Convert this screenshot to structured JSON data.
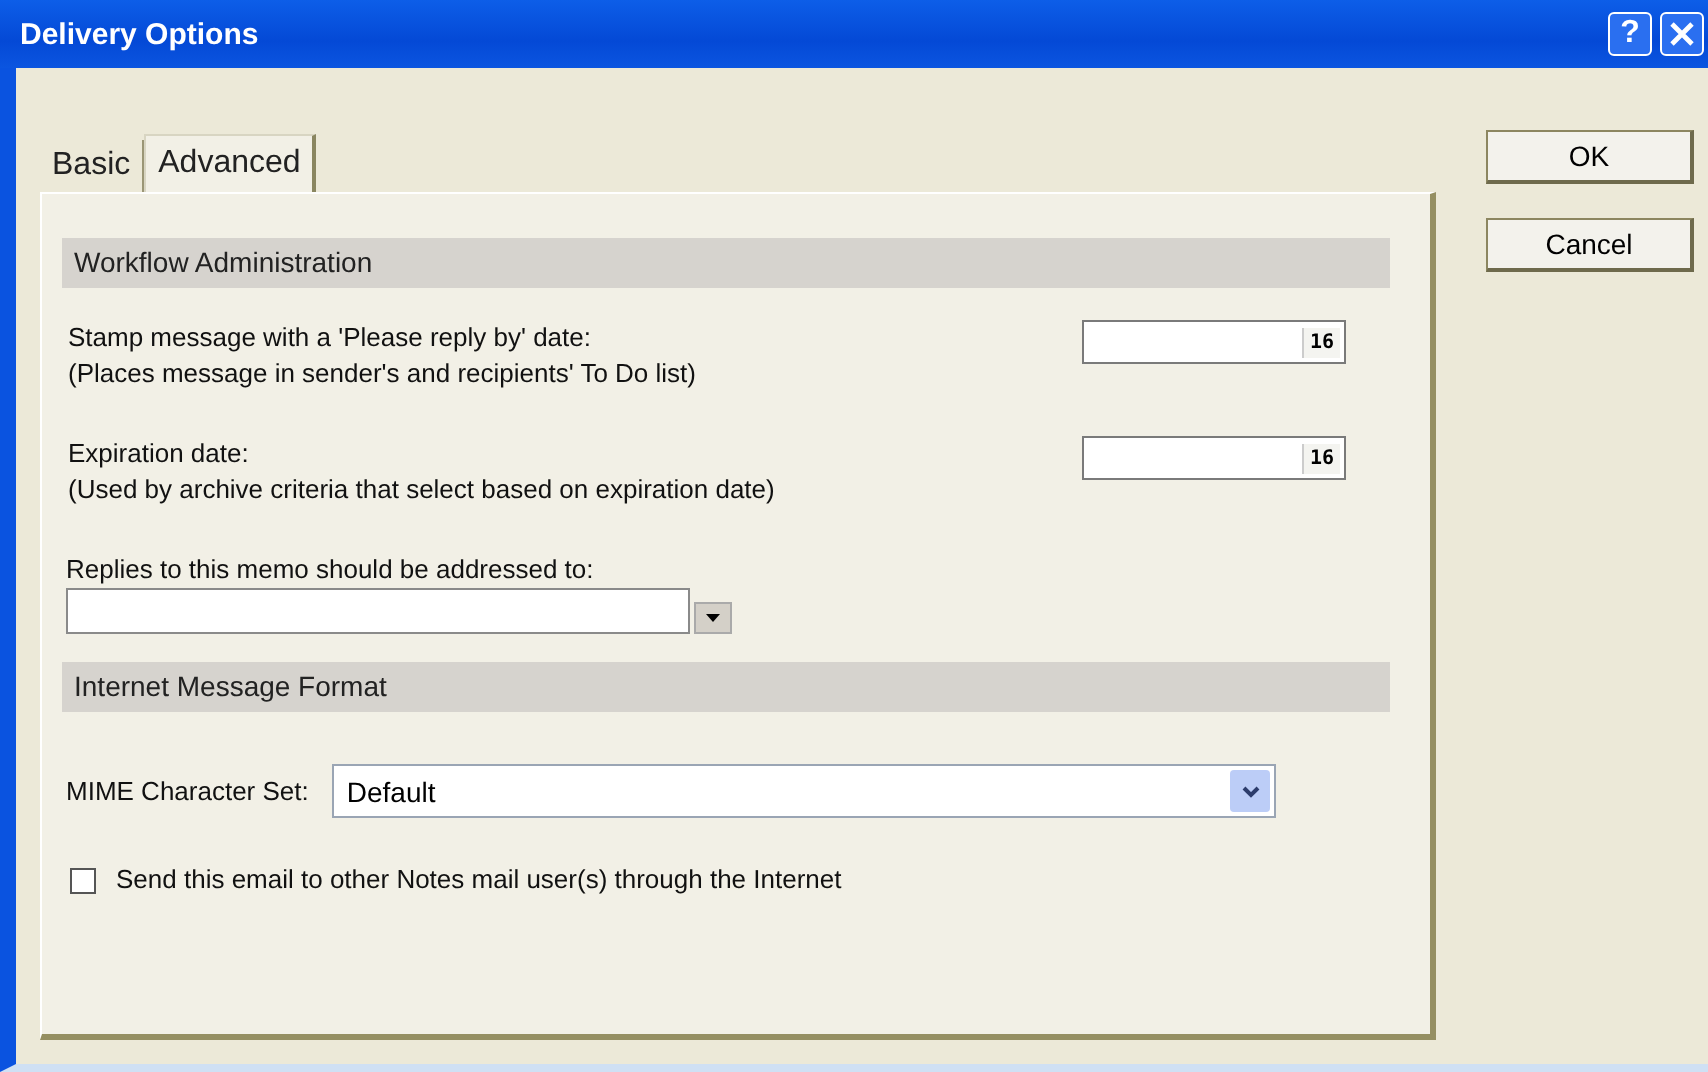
{
  "window": {
    "title": "Delivery Options",
    "help": "?"
  },
  "tabs": [
    {
      "label": "Basic",
      "selected": false
    },
    {
      "label": "Advanced",
      "selected": true
    }
  ],
  "sections": [
    {
      "title": "Workflow Administration",
      "rows": [
        {
          "kind": "date",
          "label": "Stamp message with a 'Please reply by' date:",
          "note": "(Places message in sender's and recipients' To Do list)",
          "calendar": "16"
        },
        {
          "kind": "date",
          "label": "Expiration date:",
          "note": "(Used by archive criteria that select based on expiration date)",
          "calendar": "16"
        },
        {
          "kind": "combo",
          "label": "Replies to this memo should be addressed to:"
        }
      ]
    },
    {
      "title": "Internet Message Format",
      "rows": [
        {
          "kind": "select",
          "label": "MIME Character Set:",
          "value": "Default"
        },
        {
          "kind": "checkbox",
          "label": "Send this email to other Notes mail user(s) through the Internet",
          "checked": false
        }
      ]
    }
  ],
  "buttons": [
    "OK",
    "Cancel"
  ]
}
